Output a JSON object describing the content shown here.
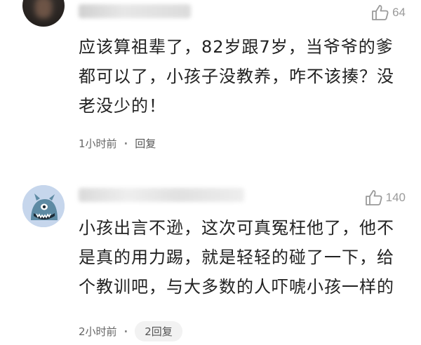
{
  "comments": [
    {
      "like_count": "64",
      "text": "应该算祖辈了，82岁跟7岁，当爷爷的爹\n都可以了，小孩子没教养，咋不该揍？没\n老没少的！",
      "time": "1小时前",
      "separator": "·",
      "reply_label": "回复"
    },
    {
      "like_count": "140",
      "text": "小孩出言不逊，这次可真冤枉他了，他不\n是真的用力踢，就是轻轻的碰了一下，给\n个教训吧，与大多数的人吓唬小孩一样的",
      "time": "2小时前",
      "separator": "·",
      "reply_label": "2回复"
    }
  ],
  "icons": {
    "like": "thumbs-up-outline-icon"
  },
  "colors": {
    "text_primary": "#222222",
    "text_meta": "#666666",
    "like_gray": "#9a9a9a",
    "avatar2_bg": "#c6d6ec",
    "avatar2_monster": "#5d8aa3"
  }
}
